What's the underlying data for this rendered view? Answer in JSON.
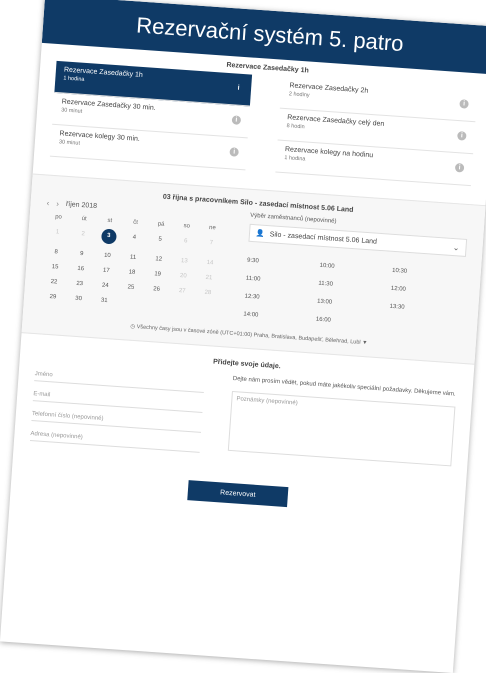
{
  "header": {
    "title": "Rezervační systém 5. patro"
  },
  "services": {
    "title": "Rezervace Zasedačky 1h",
    "items": [
      {
        "name": "Rezervace Zasedačky 1h",
        "duration": "1 hodina",
        "selected": true
      },
      {
        "name": "Rezervace Zasedačky 2h",
        "duration": "2 hodiny",
        "selected": false
      },
      {
        "name": "Rezervace Zasedačky 30 min.",
        "duration": "30 minut",
        "selected": false
      },
      {
        "name": "Rezervace Zasedačky celý den",
        "duration": "8 hodin",
        "selected": false
      },
      {
        "name": "Rezervace kolegy 30 min.",
        "duration": "30 minut",
        "selected": false
      },
      {
        "name": "Rezervace kolegy na hodinu",
        "duration": "1 hodina",
        "selected": false
      }
    ]
  },
  "booking": {
    "title": "03 října s pracovníkem Silo - zasedací místnost 5.06 Land",
    "calendar": {
      "month": "říjen 2018",
      "weekdays": [
        "po",
        "út",
        "st",
        "čt",
        "pá",
        "so",
        "ne"
      ],
      "days": [
        "1",
        "2",
        "3",
        "4",
        "5",
        "6",
        "7",
        "8",
        "9",
        "10",
        "11",
        "12",
        "13",
        "14",
        "15",
        "16",
        "17",
        "18",
        "19",
        "20",
        "21",
        "22",
        "23",
        "24",
        "25",
        "26",
        "27",
        "28",
        "29",
        "30",
        "31"
      ],
      "selected": "3"
    },
    "staff": {
      "label": "Výběr zaměstnanců (nepovinné)",
      "value": "Silo - zasedací místnost 5.06 Land"
    },
    "slots": [
      "9:30",
      "10:00",
      "10:30",
      "11:00",
      "11:30",
      "12:00",
      "12:30",
      "13:00",
      "13:30",
      "14:00",
      "16:00"
    ],
    "timezone": "Všechny časy jsou v časové zóně (UTC+01:00) Praha, Bratislava, Budapešť, Bělehrad, Lubl"
  },
  "details": {
    "title": "Přidejte svoje údaje.",
    "fields": [
      "Jméno",
      "E-mail",
      "Telefonní číslo (nepovinné)",
      "Adresa (nepovinné)"
    ],
    "notes_hint": "Dejte nám prosím vědět, pokud máte jakékoliv speciální požadavky. Děkujeme vám.",
    "notes_placeholder": "Poznámky (nepovinné)"
  },
  "submit_label": "Rezervovat",
  "colors": {
    "brand": "#0f3a66"
  }
}
